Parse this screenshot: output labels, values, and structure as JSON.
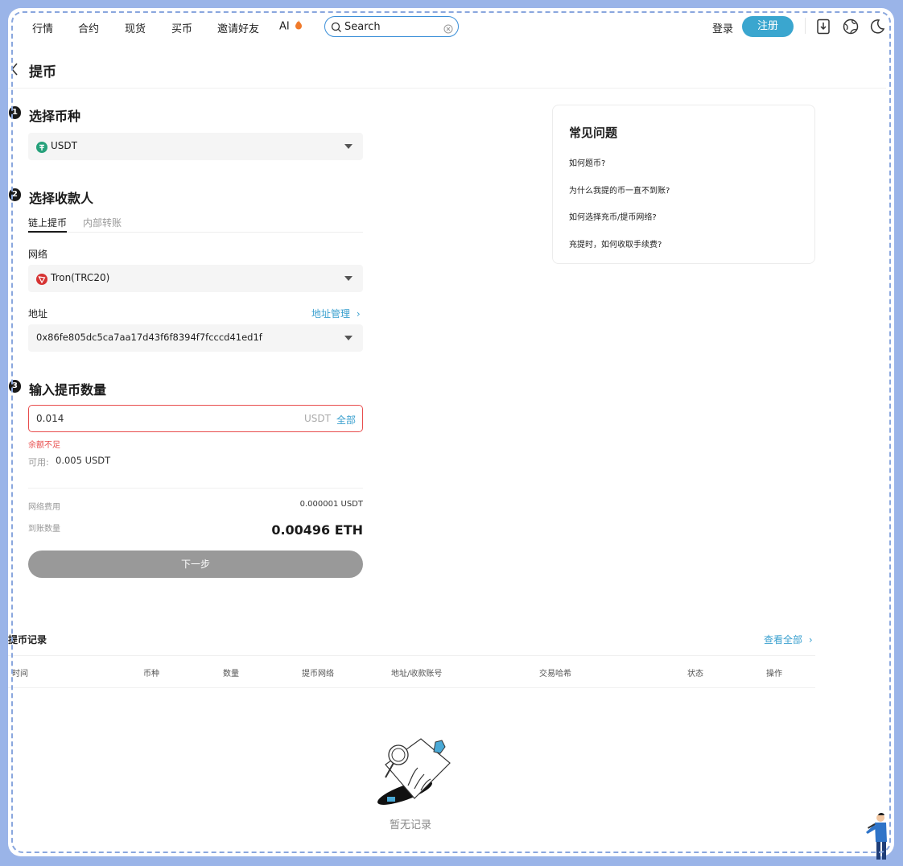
{
  "nav": {
    "items": [
      "行情",
      "合约",
      "现货",
      "买币",
      "邀请好友"
    ],
    "ai_label": "AI",
    "search_value": "Search",
    "login": "登录",
    "register": "注册"
  },
  "page": {
    "title": "提币"
  },
  "steps": {
    "s1": {
      "num": "1",
      "title": "选择币种"
    },
    "s2": {
      "num": "2",
      "title": "选择收款人"
    },
    "s3": {
      "num": "3",
      "title": "输入提币数量"
    }
  },
  "coin": {
    "name": "USDT"
  },
  "tabs": {
    "onchain": "链上提币",
    "internal": "内部转账"
  },
  "network": {
    "label": "网络",
    "value": "Tron(TRC20)"
  },
  "address": {
    "label": "地址",
    "manage_link": "地址管理",
    "value": "0x86fe805dc5ca7aa17d43f6f8394f7fcccd41ed1f"
  },
  "amount": {
    "value": "0.014",
    "unit": "USDT",
    "all": "全部",
    "error": "余额不足",
    "available_label": "可用:",
    "available_value": "0.005 USDT"
  },
  "fee": {
    "network_fee_label": "网络费用",
    "network_fee_value": "0.000001 USDT",
    "receive_label": "到账数量",
    "receive_value": "0.00496 ETH"
  },
  "submit": "下一步",
  "faq": {
    "title": "常见问题",
    "questions": [
      "如何题币?",
      "为什么我提的币一直不到账?",
      "如何选择充币/提币网络?",
      "充提时，如何收取手续费?"
    ]
  },
  "records": {
    "title": "提币记录",
    "view_all": "查看全部",
    "columns": [
      "时间",
      "币种",
      "数量",
      "提币网络",
      "地址/收款账号",
      "交易哈希",
      "状态",
      "操作"
    ],
    "empty": "暂无记录"
  },
  "colors": {
    "accent": "#3aa6cf",
    "error": "#e84d4d",
    "usdt": "#26a17b",
    "tron": "#d63333",
    "disabled_button": "#999999"
  }
}
